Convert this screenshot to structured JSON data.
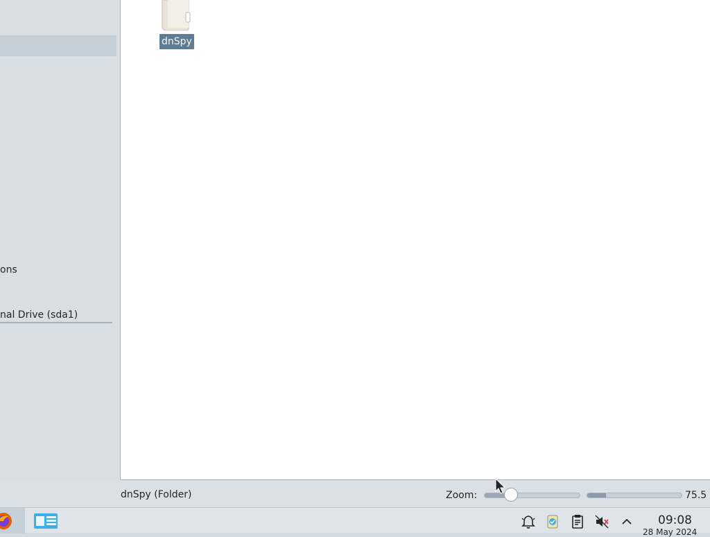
{
  "sidebar": {
    "items": [
      {
        "label": "",
        "selected": true
      },
      {
        "label": "ons",
        "selected": false
      },
      {
        "label": "nal Drive (sda1)",
        "selected": false
      }
    ]
  },
  "main": {
    "files": [
      {
        "name": "dnSpy",
        "icon": "folder-icon",
        "selected": true
      }
    ]
  },
  "statusbar": {
    "text": "dnSpy (Folder)",
    "zoom_label": "Zoom:",
    "zoom_value": "75.5",
    "zoom_level": 0.28,
    "space_used": 0.2
  },
  "taskbar": {
    "apps": [
      {
        "icon": "firefox-icon",
        "active": true
      },
      {
        "icon": "file-manager-icon",
        "active": false
      }
    ],
    "tray": [
      "notifications-icon",
      "updates-icon",
      "clipboard-icon",
      "volume-muted-icon",
      "expand-tray-icon"
    ],
    "clock_time": "09:08",
    "clock_date": "28 May 2024"
  },
  "colors": {
    "accent": "#8fb4d4",
    "selection": "#5f7c93"
  }
}
